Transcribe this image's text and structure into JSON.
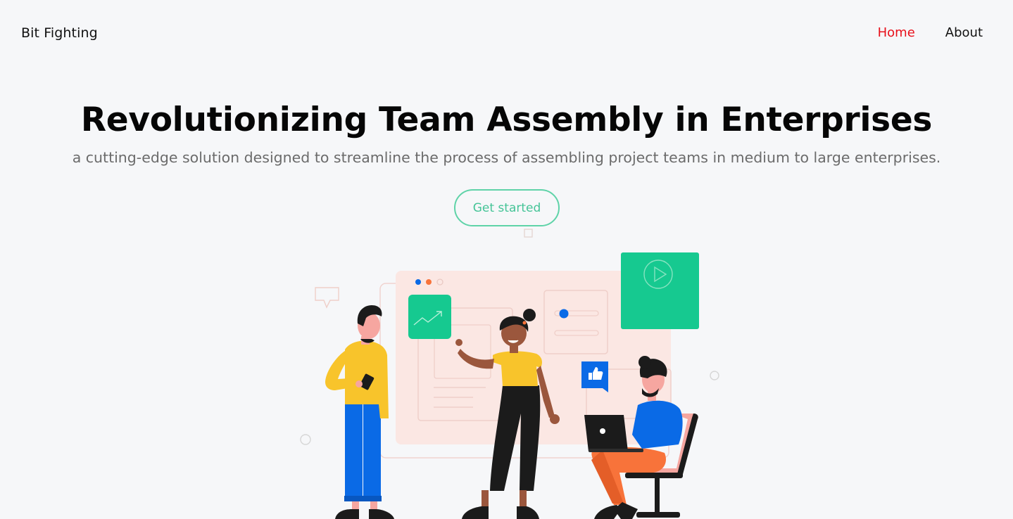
{
  "header": {
    "brand": "Bit Fighting",
    "nav": [
      {
        "label": "Home",
        "active": true
      },
      {
        "label": "About",
        "active": false
      }
    ]
  },
  "hero": {
    "title": "Revolutionizing Team Assembly in Enterprises",
    "subtitle": "a cutting-edge solution designed to streamline the process of assembling project teams in medium to large enterprises.",
    "cta_label": "Get started"
  },
  "colors": {
    "background": "#f6f7f9",
    "nav_active": "#e8101b",
    "cta_accent": "#5fd3a8",
    "illustration_green": "#16c990",
    "illustration_blue": "#0a6ae6",
    "illustration_yellow": "#f8c42b",
    "illustration_orange": "#f8733a",
    "board_pink": "#fbe7e3"
  },
  "illustration": {
    "icons": [
      "chart-up-icon",
      "play-icon",
      "thumbs-up-icon",
      "speech-bubble-icon"
    ]
  }
}
